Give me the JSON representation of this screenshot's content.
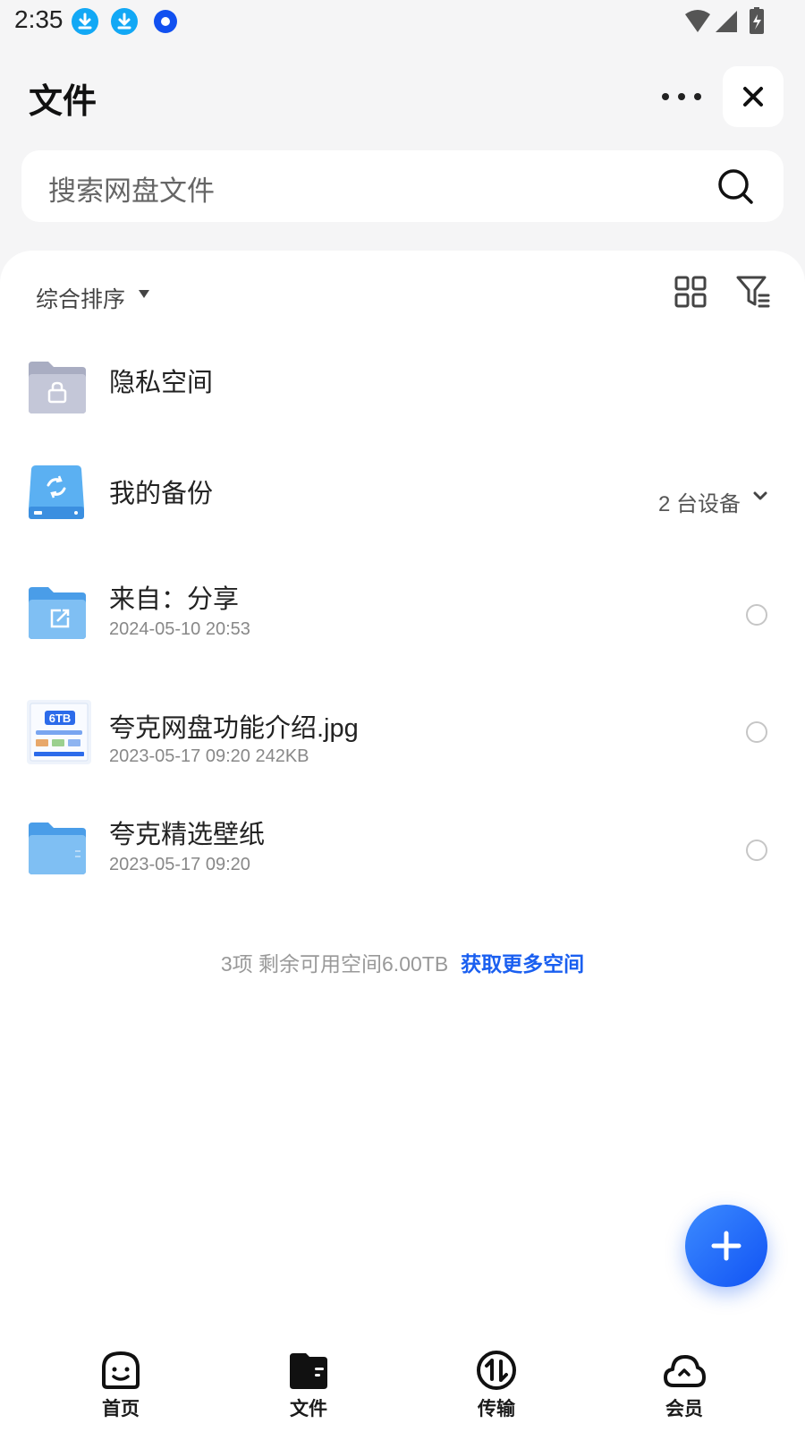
{
  "status_bar": {
    "time": "2:35"
  },
  "header": {
    "title": "文件"
  },
  "search": {
    "placeholder": "搜索网盘文件"
  },
  "sort": {
    "label": "综合排序"
  },
  "files": [
    {
      "name": "隐私空间",
      "meta": ""
    },
    {
      "name": "我的备份",
      "meta": "",
      "devices": "2 台设备"
    },
    {
      "name": "来自：分享",
      "meta": "2024-05-10 20:53"
    },
    {
      "name": "夸克网盘功能介绍.jpg",
      "meta": "2023-05-17 09:20  242KB",
      "thumb_text": "6TB"
    },
    {
      "name": "夸克精选壁纸",
      "meta": "2023-05-17 09:20"
    }
  ],
  "footer": {
    "summary": "3项 剩余可用空间6.00TB",
    "link": "获取更多空间"
  },
  "nav": [
    {
      "label": "首页",
      "icon": "smiley-home-icon"
    },
    {
      "label": "文件",
      "icon": "folder-icon"
    },
    {
      "label": "传输",
      "icon": "transfer-icon"
    },
    {
      "label": "会员",
      "icon": "cloud-icon"
    }
  ],
  "colors": {
    "accent": "#1a5ff0",
    "background": "#f5f5f6",
    "panel": "#ffffff"
  }
}
